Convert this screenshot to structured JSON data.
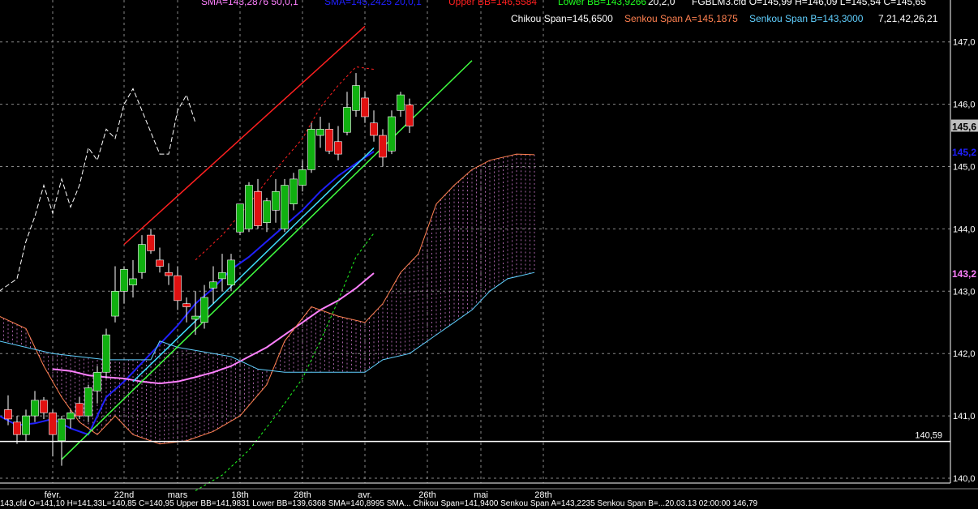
{
  "header": {
    "line1": [
      {
        "text": "SMA=143,2876  50,0,1",
        "color": "#ff80ff"
      },
      {
        "text": "SMA=145,2425  20,0,1",
        "color": "#2020ff"
      },
      {
        "text": "Upper BB=146,5584",
        "color": "#ff2020"
      },
      {
        "text": "Lower BB=143,9266",
        "color": "#20ff20"
      },
      {
        "text": "20,2,0",
        "color": "#ffffff"
      },
      {
        "text": "FGBLM3.cfd O=145,99 H=146,09 L=145,54 C=145,65",
        "color": "#ffffff"
      }
    ],
    "line2": [
      {
        "text": "Chikou Span=145,6500",
        "color": "#ffffff"
      },
      {
        "text": "Senkou Span A=145,1875",
        "color": "#ff8050"
      },
      {
        "text": "Senkou Span B=143,3000",
        "color": "#60d0ff"
      },
      {
        "text": "7,21,42,26,21",
        "color": "#ffffff"
      }
    ]
  },
  "price_axis": {
    "ticks": [
      "147,0",
      "146,0",
      "145,0",
      "144,0",
      "143,0",
      "142,0",
      "141,0",
      "140,0"
    ],
    "markers": [
      {
        "text": "145,6",
        "value": 145.65,
        "color": "#000000",
        "bg": "#c0c0c0"
      },
      {
        "text": "145,2",
        "value": 145.24,
        "color": "#2020ff",
        "bg": ""
      },
      {
        "text": "143,2",
        "value": 143.29,
        "color": "#ff80ff",
        "bg": ""
      }
    ]
  },
  "horizontal_line": {
    "value": 140.59,
    "label": "140,59"
  },
  "footer": "143,cfd O=141,10 H=141,33L=140,85 C=140,95 Upper BB=141,9831 Lower BB=139,6368 SMA=140,8995 SMA... Chikou Span=141,9400 Senkou Span A=143,2235 Senkou Span B=...20.03.13 02:00:00 146,79",
  "chart_data": {
    "type": "candlestick",
    "instrument": "FGBLM3.cfd",
    "ylim": [
      139.9,
      147.5
    ],
    "x_ticks": [
      {
        "label": "févr.",
        "index": 5
      },
      {
        "label": "22nd",
        "index": 13
      },
      {
        "label": "mars",
        "index": 19
      },
      {
        "label": "18th",
        "index": 26
      },
      {
        "label": "28th",
        "index": 33
      },
      {
        "label": "avr.",
        "index": 40
      },
      {
        "label": "26th",
        "index": 47
      },
      {
        "label": "mai",
        "index": 53
      },
      {
        "label": "28th",
        "index": 60
      }
    ],
    "candles": [
      {
        "o": 141.1,
        "h": 141.33,
        "l": 140.85,
        "c": 140.95
      },
      {
        "o": 140.9,
        "h": 141.0,
        "l": 140.55,
        "c": 140.7
      },
      {
        "o": 140.7,
        "h": 141.1,
        "l": 140.6,
        "c": 141.0
      },
      {
        "o": 141.0,
        "h": 141.4,
        "l": 140.9,
        "c": 141.25
      },
      {
        "o": 141.25,
        "h": 141.3,
        "l": 140.95,
        "c": 141.05
      },
      {
        "o": 141.05,
        "h": 141.1,
        "l": 140.35,
        "c": 140.7
      },
      {
        "o": 140.6,
        "h": 141.0,
        "l": 140.2,
        "c": 140.95
      },
      {
        "o": 140.95,
        "h": 141.1,
        "l": 140.8,
        "c": 141.05
      },
      {
        "o": 141.2,
        "h": 141.3,
        "l": 140.95,
        "c": 141.0
      },
      {
        "o": 141.0,
        "h": 141.5,
        "l": 140.9,
        "c": 141.45
      },
      {
        "o": 141.4,
        "h": 141.8,
        "l": 141.2,
        "c": 141.7
      },
      {
        "o": 141.7,
        "h": 142.4,
        "l": 141.6,
        "c": 142.3
      },
      {
        "o": 142.6,
        "h": 143.4,
        "l": 142.5,
        "c": 143.0
      },
      {
        "o": 143.0,
        "h": 143.4,
        "l": 142.8,
        "c": 143.35
      },
      {
        "o": 143.1,
        "h": 143.5,
        "l": 142.9,
        "c": 143.2
      },
      {
        "o": 143.3,
        "h": 143.9,
        "l": 143.2,
        "c": 143.75
      },
      {
        "o": 143.9,
        "h": 144.0,
        "l": 143.6,
        "c": 143.65
      },
      {
        "o": 143.5,
        "h": 143.7,
        "l": 143.3,
        "c": 143.4
      },
      {
        "o": 143.3,
        "h": 143.45,
        "l": 143.1,
        "c": 143.25
      },
      {
        "o": 143.25,
        "h": 143.4,
        "l": 142.7,
        "c": 142.85
      },
      {
        "o": 142.8,
        "h": 142.9,
        "l": 142.5,
        "c": 142.75
      },
      {
        "o": 142.55,
        "h": 143.0,
        "l": 142.3,
        "c": 142.6
      },
      {
        "o": 142.5,
        "h": 143.1,
        "l": 142.4,
        "c": 142.9
      },
      {
        "o": 143.05,
        "h": 143.4,
        "l": 142.8,
        "c": 143.15
      },
      {
        "o": 143.2,
        "h": 143.6,
        "l": 143.0,
        "c": 143.3
      },
      {
        "o": 143.1,
        "h": 143.6,
        "l": 143.0,
        "c": 143.5
      },
      {
        "o": 143.95,
        "h": 144.1,
        "l": 143.9,
        "c": 144.4
      },
      {
        "o": 144.0,
        "h": 144.75,
        "l": 143.95,
        "c": 144.7
      },
      {
        "o": 144.6,
        "h": 144.8,
        "l": 144.0,
        "c": 144.05
      },
      {
        "o": 144.1,
        "h": 144.5,
        "l": 143.95,
        "c": 144.45
      },
      {
        "o": 144.3,
        "h": 144.8,
        "l": 144.1,
        "c": 144.6
      },
      {
        "o": 144.0,
        "h": 144.8,
        "l": 143.95,
        "c": 144.7
      },
      {
        "o": 144.4,
        "h": 144.9,
        "l": 144.3,
        "c": 144.8
      },
      {
        "o": 144.7,
        "h": 145.1,
        "l": 144.6,
        "c": 144.95
      },
      {
        "o": 144.95,
        "h": 145.7,
        "l": 144.9,
        "c": 145.6
      },
      {
        "o": 145.5,
        "h": 145.8,
        "l": 145.3,
        "c": 145.6
      },
      {
        "o": 145.6,
        "h": 145.7,
        "l": 145.2,
        "c": 145.25
      },
      {
        "o": 145.4,
        "h": 145.65,
        "l": 145.1,
        "c": 145.2
      },
      {
        "o": 145.55,
        "h": 146.2,
        "l": 145.5,
        "c": 145.95
      },
      {
        "o": 145.9,
        "h": 146.5,
        "l": 145.8,
        "c": 146.3
      },
      {
        "o": 146.1,
        "h": 146.2,
        "l": 145.7,
        "c": 145.8
      },
      {
        "o": 145.7,
        "h": 145.9,
        "l": 145.4,
        "c": 145.5
      },
      {
        "o": 145.5,
        "h": 145.6,
        "l": 145.0,
        "c": 145.15
      },
      {
        "o": 145.25,
        "h": 145.9,
        "l": 145.2,
        "c": 145.8
      },
      {
        "o": 145.9,
        "h": 146.2,
        "l": 145.8,
        "c": 146.15
      },
      {
        "o": 145.99,
        "h": 146.09,
        "l": 145.54,
        "c": 145.65
      }
    ],
    "series": [
      {
        "name": "SMA",
        "color": "#2020ff",
        "points": [
          [
            -1,
            141.0
          ],
          [
            1,
            140.85
          ],
          [
            3,
            140.88
          ],
          [
            5,
            140.95
          ],
          [
            7,
            140.8
          ],
          [
            9,
            140.7
          ],
          [
            11,
            141.3
          ],
          [
            13,
            141.55
          ],
          [
            15,
            141.85
          ],
          [
            17,
            142.15
          ],
          [
            19,
            142.45
          ],
          [
            21,
            142.8
          ],
          [
            23,
            143.05
          ],
          [
            25,
            143.35
          ],
          [
            27,
            143.55
          ],
          [
            29,
            143.8
          ],
          [
            31,
            144.05
          ],
          [
            33,
            144.3
          ],
          [
            35,
            144.6
          ],
          [
            37,
            144.85
          ],
          [
            39,
            145.05
          ],
          [
            41,
            145.24
          ]
        ]
      },
      {
        "name": "SMA",
        "color": "#ff80ff",
        "points": [
          [
            5,
            141.75
          ],
          [
            7,
            141.72
          ],
          [
            9,
            141.65
          ],
          [
            11,
            141.62
          ],
          [
            13,
            141.6
          ],
          [
            15,
            141.55
          ],
          [
            17,
            141.52
          ],
          [
            19,
            141.55
          ],
          [
            21,
            141.62
          ],
          [
            23,
            141.7
          ],
          [
            25,
            141.8
          ],
          [
            27,
            141.95
          ],
          [
            29,
            142.1
          ],
          [
            31,
            142.3
          ],
          [
            33,
            142.5
          ],
          [
            35,
            142.7
          ],
          [
            37,
            142.85
          ],
          [
            39,
            143.05
          ],
          [
            41,
            143.29
          ]
        ]
      },
      {
        "name": "Upper BB",
        "color": "#ff2020",
        "points": [
          [
            21,
            143.5
          ],
          [
            24,
            143.9
          ],
          [
            27,
            144.4
          ],
          [
            30,
            144.95
          ],
          [
            33,
            145.45
          ],
          [
            35,
            145.95
          ],
          [
            37,
            146.3
          ],
          [
            39,
            146.6
          ],
          [
            41,
            146.56
          ]
        ]
      },
      {
        "name": "Lower BB",
        "color": "#20ff20",
        "points": [
          [
            21,
            139.8
          ],
          [
            24,
            140.05
          ],
          [
            27,
            140.45
          ],
          [
            30,
            141.0
          ],
          [
            33,
            141.6
          ],
          [
            35,
            142.2
          ],
          [
            37,
            142.85
          ],
          [
            39,
            143.55
          ],
          [
            41,
            143.93
          ]
        ]
      },
      {
        "name": "Chikou Span",
        "color": "#ffffff",
        "dashed": true,
        "points": [
          [
            -1,
            143.0
          ],
          [
            0,
            143.1
          ],
          [
            1,
            143.2
          ],
          [
            2,
            143.8
          ],
          [
            3,
            144.2
          ],
          [
            4,
            144.7
          ],
          [
            5,
            144.25
          ],
          [
            6,
            144.8
          ],
          [
            7,
            144.35
          ],
          [
            8,
            144.7
          ],
          [
            9,
            145.3
          ],
          [
            10,
            145.1
          ],
          [
            11,
            145.6
          ],
          [
            12,
            145.45
          ],
          [
            13,
            146.0
          ],
          [
            14,
            146.25
          ],
          [
            15,
            145.9
          ],
          [
            16,
            145.55
          ],
          [
            17,
            145.2
          ],
          [
            18,
            145.2
          ],
          [
            19,
            145.9
          ],
          [
            20,
            146.15
          ],
          [
            21,
            145.7
          ]
        ]
      },
      {
        "name": "Senkou Span A",
        "color": "#ff8050",
        "points": [
          [
            -1,
            142.6
          ],
          [
            2,
            142.4
          ],
          [
            4,
            141.8
          ],
          [
            6,
            141.3
          ],
          [
            8,
            140.9
          ],
          [
            10,
            140.7
          ],
          [
            12,
            141.0
          ],
          [
            14,
            140.7
          ],
          [
            17,
            140.55
          ],
          [
            20,
            140.6
          ],
          [
            23,
            140.75
          ],
          [
            26,
            141.0
          ],
          [
            29,
            141.5
          ],
          [
            31,
            142.2
          ],
          [
            34,
            142.75
          ],
          [
            37,
            142.6
          ],
          [
            40,
            142.5
          ],
          [
            42,
            142.8
          ],
          [
            44,
            143.3
          ],
          [
            46,
            143.6
          ],
          [
            48,
            144.4
          ],
          [
            50,
            144.7
          ],
          [
            52,
            144.95
          ],
          [
            54,
            145.1
          ],
          [
            57,
            145.2
          ],
          [
            59,
            145.19
          ]
        ]
      },
      {
        "name": "Senkou Span B",
        "color": "#60d0ff",
        "points": [
          [
            -1,
            142.2
          ],
          [
            5,
            142.0
          ],
          [
            11,
            141.9
          ],
          [
            16,
            141.9
          ],
          [
            17,
            142.2
          ],
          [
            19,
            142.1
          ],
          [
            25,
            141.95
          ],
          [
            28,
            141.75
          ],
          [
            31,
            141.7
          ],
          [
            34,
            141.7
          ],
          [
            37,
            141.7
          ],
          [
            40,
            141.7
          ],
          [
            42,
            141.9
          ],
          [
            45,
            142.0
          ],
          [
            48,
            142.3
          ],
          [
            50,
            142.5
          ],
          [
            52,
            142.7
          ],
          [
            54,
            143.0
          ],
          [
            56,
            143.2
          ],
          [
            59,
            143.3
          ]
        ]
      }
    ],
    "trendlines": [
      {
        "name": "resistance",
        "color": "#ff2020",
        "from": [
          13,
          143.75
        ],
        "to": [
          40,
          147.25
        ]
      },
      {
        "name": "support-green",
        "color": "#40ff40",
        "from": [
          6,
          140.3
        ],
        "to": [
          52,
          146.7
        ]
      },
      {
        "name": "support-cyan",
        "color": "#40e0ff",
        "from": [
          14,
          141.55
        ],
        "to": [
          41,
          145.3
        ]
      }
    ]
  }
}
